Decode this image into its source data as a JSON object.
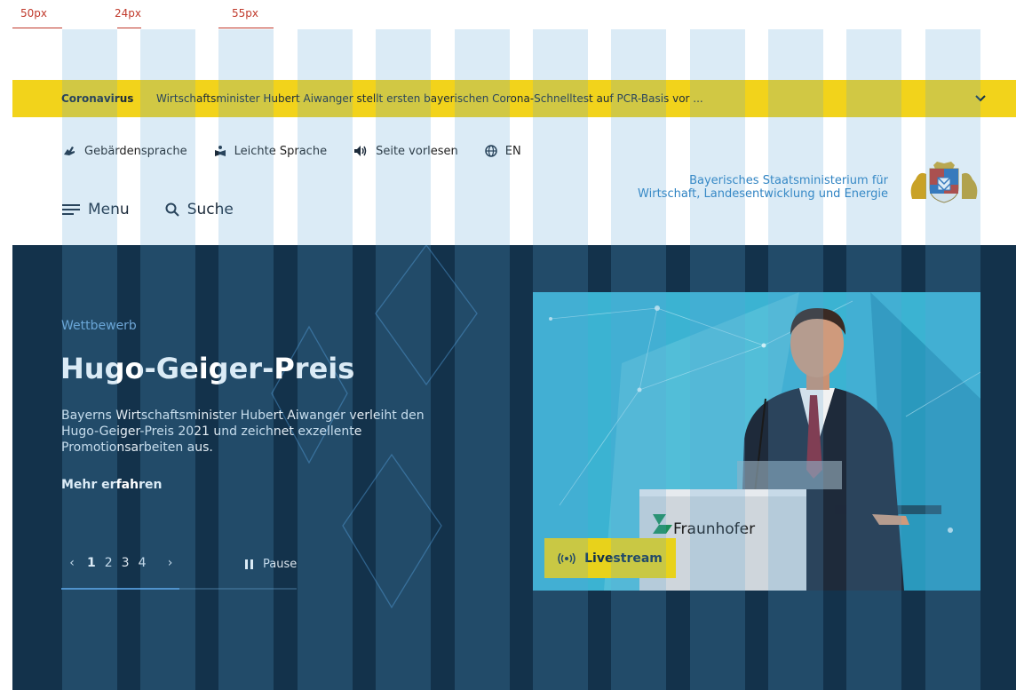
{
  "annotations": [
    "50px",
    "24px",
    "55px"
  ],
  "corona": {
    "label": "Coronavirus",
    "text": "Wirtschaftsminister Hubert Aiwanger stellt ersten bayerischen Corona-Schnelltest auf PCR-Basis vor ..."
  },
  "utility": [
    {
      "label": "Gebärdensprache",
      "icon": "sign-language-icon"
    },
    {
      "label": "Leichte Sprache",
      "icon": "easy-language-icon"
    },
    {
      "label": "Seite vorlesen",
      "icon": "speaker-icon"
    },
    {
      "label": "EN",
      "icon": "globe-icon"
    }
  ],
  "nav": {
    "menu_label": "Menu",
    "search_label": "Suche"
  },
  "ministry": {
    "line1": "Bayerisches Staatsministerium für",
    "line2": "Wirtschaft, Landesentwicklung und Energie"
  },
  "hero": {
    "kicker": "Wettbewerb",
    "title": "Hugo-Geiger-Preis",
    "description": "Bayerns Wirtschaftsminister Hubert Aiwanger verleiht den Hugo-Geiger-Preis 2021 und zeichnet exzellente Promotionsarbeiten aus.",
    "more": "Mehr erfahren",
    "pages": [
      "1",
      "2",
      "3",
      "4"
    ],
    "active_page": 1,
    "pause": "Pause",
    "progress": 0.5
  },
  "photo": {
    "brand": "Fraunhofer"
  },
  "live": {
    "label": "Livestream"
  },
  "colors": {
    "accent": "#f2d31b",
    "hero_bg": "#13324b",
    "ministry_blue": "#2d82c2"
  }
}
